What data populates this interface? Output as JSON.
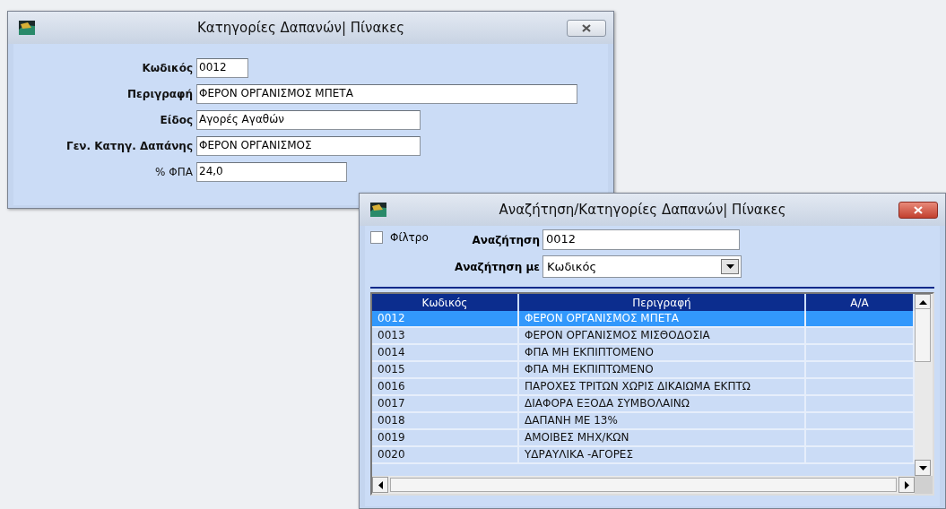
{
  "detail_window": {
    "title": "Κατηγορίες Δαπανών| Πίνακες",
    "fields": [
      {
        "label": "Κωδικός",
        "value": "0012",
        "bold": true
      },
      {
        "label": "Περιγραφή",
        "value": "ΦΕΡΟΝ ΟΡΓΑΝΙΣΜΟΣ ΜΠΕΤΑ",
        "bold": true
      },
      {
        "label": "Είδος",
        "value": "Αγορές Αγαθών",
        "bold": true
      },
      {
        "label": "Γεν. Κατηγ. Δαπάνης",
        "value": "ΦΕΡΟΝ ΟΡΓΑΝΙΣΜΟΣ",
        "bold": true
      },
      {
        "label": "% ΦΠΑ",
        "value": "24,0",
        "bold": false
      }
    ]
  },
  "search_window": {
    "title": "Αναζήτηση/Κατηγορίες Δαπανών| Πίνακες",
    "filter": {
      "label": "Φίλτρο",
      "checked": false
    },
    "search": {
      "label": "Αναζήτηση",
      "value": "0012"
    },
    "search_by": {
      "label": "Αναζήτηση με",
      "value": "Κωδικός"
    },
    "table": {
      "columns": [
        "Κωδικός",
        "Περιγραφή",
        "Α/Α"
      ],
      "rows": [
        {
          "code": "0012",
          "description": "ΦΕΡΟΝ ΟΡΓΑΝΙΣΜΟΣ ΜΠΕΤΑ",
          "selected": true
        },
        {
          "code": "0013",
          "description": "ΦΕΡΟΝ ΟΡΓΑΝΙΣΜΟΣ ΜΙΣΘΟΔΟΣΙΑ",
          "selected": false
        },
        {
          "code": "0014",
          "description": "ΦΠΑ ΜΗ ΕΚΠΙΠΤΟΜΕΝΟ",
          "selected": false
        },
        {
          "code": "0015",
          "description": "ΦΠΑ ΜΗ ΕΚΠΙΠΤΩΜΕΝΟ",
          "selected": false
        },
        {
          "code": "0016",
          "description": "ΠΑΡΟΧΕΣ ΤΡΙΤΩΝ ΧΩΡΙΣ ΔΙΚΑΙΩΜΑ ΕΚΠΤΩ",
          "selected": false
        },
        {
          "code": "0017",
          "description": "ΔΙΑΦΟΡΑ ΕΞΟΔΑ ΣΥΜΒΟΛΑΙΝΩ",
          "selected": false
        },
        {
          "code": "0018",
          "description": "ΔΑΠΑΝΗ ΜΕ 13%",
          "selected": false
        },
        {
          "code": "0019",
          "description": "ΑΜΟΙΒΕΣ ΜΗΧ/ΚΩΝ",
          "selected": false
        },
        {
          "code": "0020",
          "description": "ΥΔΡΑΥΛΙΚΑ -ΑΓΟΡΕΣ",
          "selected": false
        }
      ]
    }
  }
}
